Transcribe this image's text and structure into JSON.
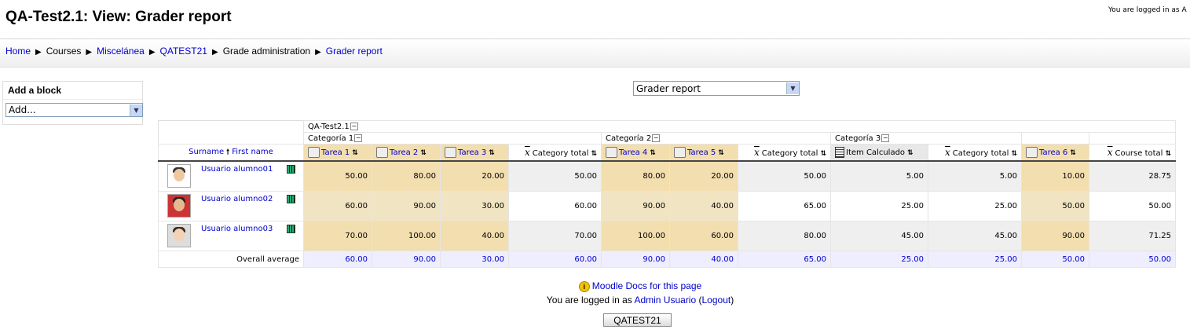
{
  "page": {
    "title": "QA-Test2.1: View: Grader report",
    "login_top": "You are logged in as A"
  },
  "breadcrumb": {
    "items": [
      "Home",
      "Courses",
      "Misceláne­a",
      "QATEST21",
      "Grade administration",
      "Grader report"
    ],
    "separator": "▶"
  },
  "block": {
    "title": "Add a block",
    "select_value": "Add..."
  },
  "report_select": {
    "value": "Grader report"
  },
  "grader": {
    "course_header": "QA-Test2.1",
    "categories": [
      "Categoría 1",
      "Categoría 2",
      "Categoría 3"
    ],
    "sort_labels": {
      "surname": "Surname",
      "firstname": "First name"
    },
    "columns": [
      "Tarea 1",
      "Tarea 2",
      "Tarea 3",
      "Category total",
      "Tarea 4",
      "Tarea 5",
      "Category total",
      "Item Calculado",
      "Category total",
      "Tarea 6",
      "Course total"
    ],
    "students": [
      {
        "name": "Usuario alumno01",
        "grades": [
          "50.00",
          "80.00",
          "20.00",
          "50.00",
          "80.00",
          "20.00",
          "50.00",
          "5.00",
          "5.00",
          "10.00",
          "28.75"
        ]
      },
      {
        "name": "Usuario alumno02",
        "grades": [
          "60.00",
          "90.00",
          "30.00",
          "60.00",
          "90.00",
          "40.00",
          "65.00",
          "25.00",
          "25.00",
          "50.00",
          "50.00"
        ]
      },
      {
        "name": "Usuario alumno03",
        "grades": [
          "70.00",
          "100.00",
          "40.00",
          "70.00",
          "100.00",
          "60.00",
          "80.00",
          "45.00",
          "45.00",
          "90.00",
          "71.25"
        ]
      }
    ],
    "average_label": "Overall average",
    "averages": [
      "60.00",
      "90.00",
      "30.00",
      "60.00",
      "90.00",
      "40.00",
      "65.00",
      "25.00",
      "25.00",
      "50.00",
      "50.00"
    ]
  },
  "footer": {
    "docs_link": "Moodle Docs for this page",
    "login_prefix": "You are logged in as",
    "user": "Admin Usuario",
    "logout": "Logout",
    "course_button": "QATEST21"
  }
}
